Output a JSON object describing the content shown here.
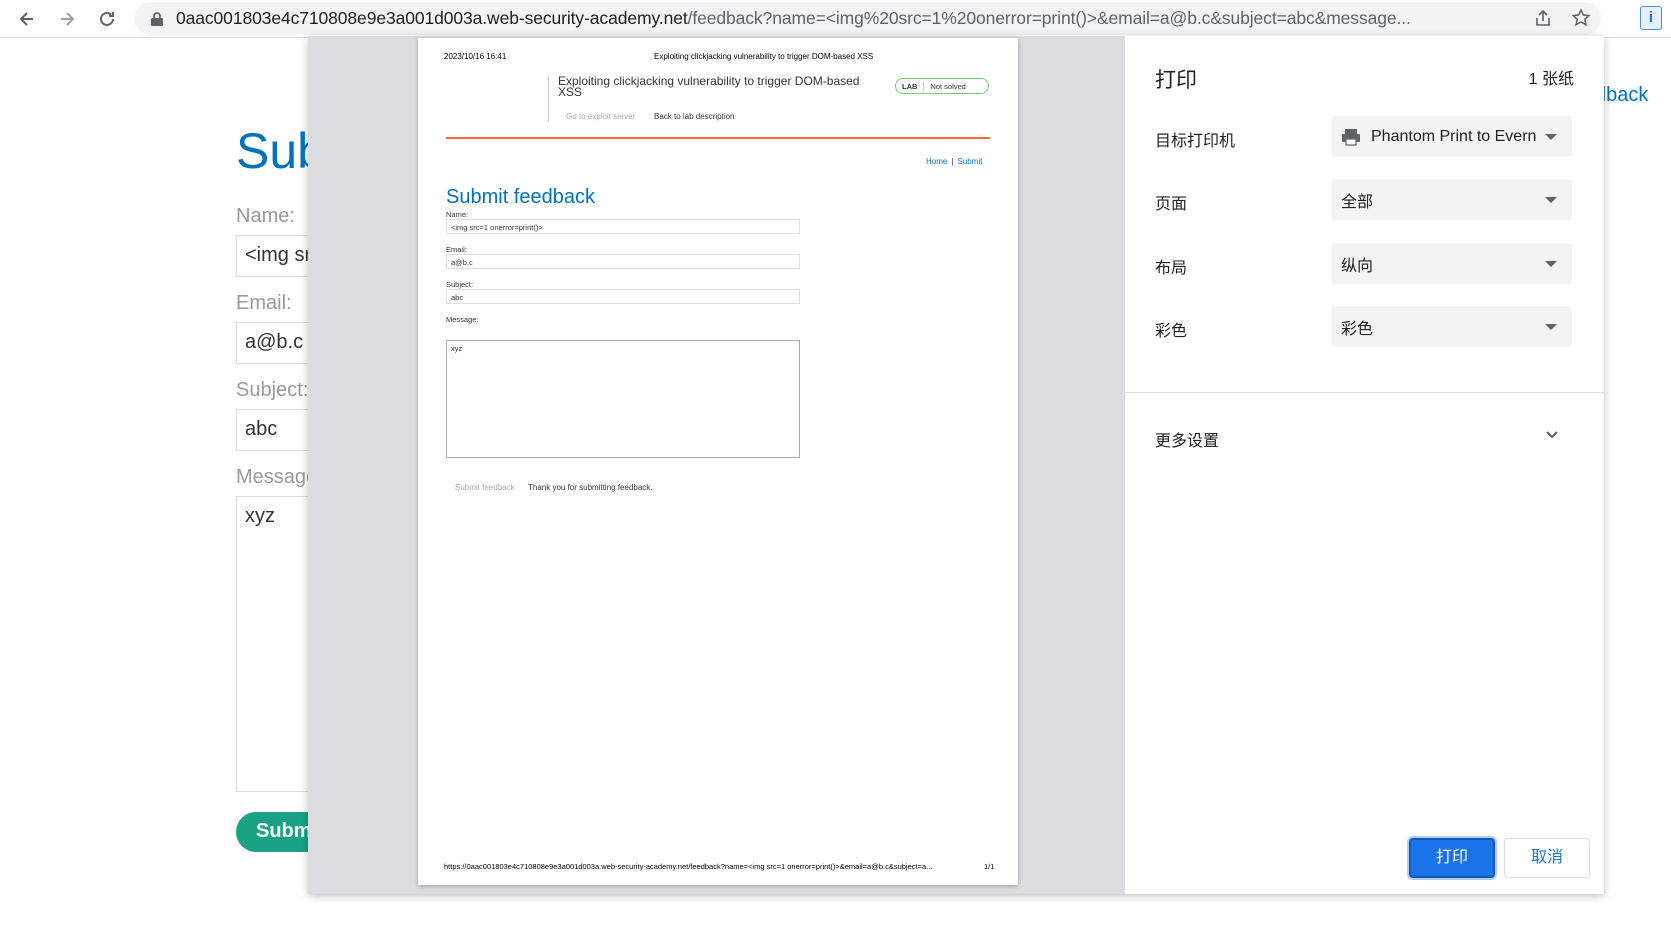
{
  "browser": {
    "url_host": "0aac001803e4c710808e9e3a001d003a.web-security-academy.net",
    "url_path": "/feedback?name=<img%20src=1%20onerror=print()>&email=a@b.c&subject=abc&message..."
  },
  "underlying_page": {
    "title": "Sub",
    "name_label": "Name:",
    "name_value": "<img sr",
    "email_label": "Email:",
    "email_value": "a@b.c",
    "subject_label": "Subject:",
    "subject_value": "abc",
    "message_label": "Message",
    "message_value": "xyz",
    "submit_label": "Subm",
    "top_link": "dback"
  },
  "preview": {
    "date": "2023/10/16 16:41",
    "header_title": "Exploiting clickjacking vulnerability to trigger DOM-based XSS",
    "lab_title": "Exploiting clickjacking vulnerability to trigger DOM-based XSS",
    "go_exploit": "Go to exploit server",
    "back_lab": "Back to lab description",
    "badge_lab": "LAB",
    "badge_status": "Not solved",
    "nav_home": "Home",
    "nav_sep": "|",
    "nav_submit": "Submit",
    "heading": "Submit feedback",
    "name_label": "Name:",
    "name_value": "<img src=1 onerror=print()>",
    "email_label": "Email:",
    "email_value": "a@b.c",
    "subject_label": "Subject:",
    "subject_value": "abc",
    "message_label": "Message:",
    "message_value": "xyz",
    "submit_label": "Submit feedback",
    "thanks": "Thank you for submitting feedback.",
    "footer_url": "https://0aac001803e4c710808e9e3a001d003a.web-security-academy.net/feedback?name=<img src=1 onerror=print()>&email=a@b.c&subject=a...",
    "footer_page": "1/1"
  },
  "settings": {
    "title": "打印",
    "sheets": "1 张纸",
    "destination_label": "目标打印机",
    "destination_value": "Phantom Print to Evernote",
    "pages_label": "页面",
    "pages_value": "全部",
    "layout_label": "布局",
    "layout_value": "纵向",
    "color_label": "彩色",
    "color_value": "彩色",
    "more_settings": "更多设置",
    "print_button": "打印",
    "cancel_button": "取消"
  }
}
